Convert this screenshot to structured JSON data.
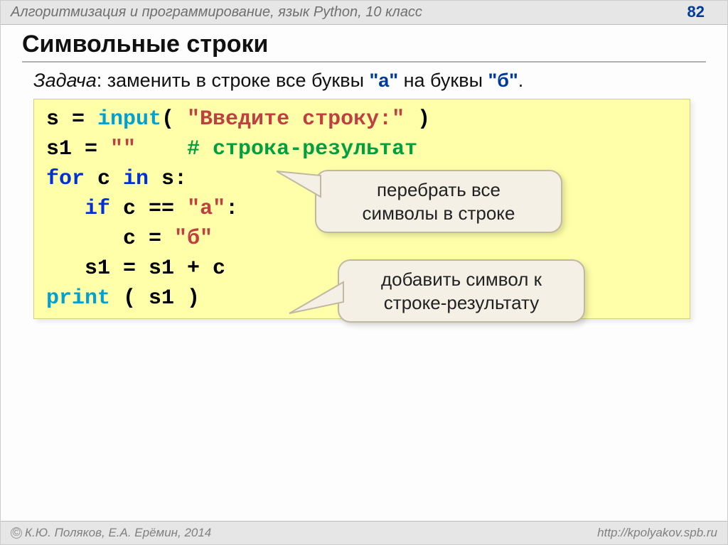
{
  "header": {
    "breadcrumb": "Алгоритмизация и программирование, язык Python, 10 класс",
    "page_number": "82"
  },
  "title": "Символьные строки",
  "task": {
    "label": "Задача",
    "before_a": ": заменить в строке все буквы ",
    "quote_a": "\"а\"",
    "middle": " на буквы ",
    "quote_b": "\"б\"",
    "end": "."
  },
  "code": {
    "l1_s": "s = ",
    "l1_fn": "input",
    "l1_paren": "( ",
    "l1_str": "\"Введите строку:\"",
    "l1_close": " )",
    "l2_s": "s1 = ",
    "l2_str": "\"\"",
    "l2_sp": "    ",
    "l2_cmt": "# строка-результат",
    "l3_for": "for",
    "l3_mid": " c ",
    "l3_in": "in",
    "l3_end": " s:",
    "l4_sp": "   ",
    "l4_if": "if",
    "l4_mid": " c == ",
    "l4_str": "\"а\"",
    "l4_colon": ":",
    "l5_sp": "      c = ",
    "l5_str": "\"б\"",
    "l6": "   s1 = s1 + c",
    "l7_fn": "print",
    "l7_rest": " ( s1 )"
  },
  "callouts": {
    "one_l1": "перебрать все",
    "one_l2": "символы в строке",
    "two_l1": "добавить символ к",
    "two_l2": "строке-результату"
  },
  "footer": {
    "copyright": "К.Ю. Поляков, Е.А. Ерёмин, 2014",
    "url": "http://kpolyakov.spb.ru"
  }
}
